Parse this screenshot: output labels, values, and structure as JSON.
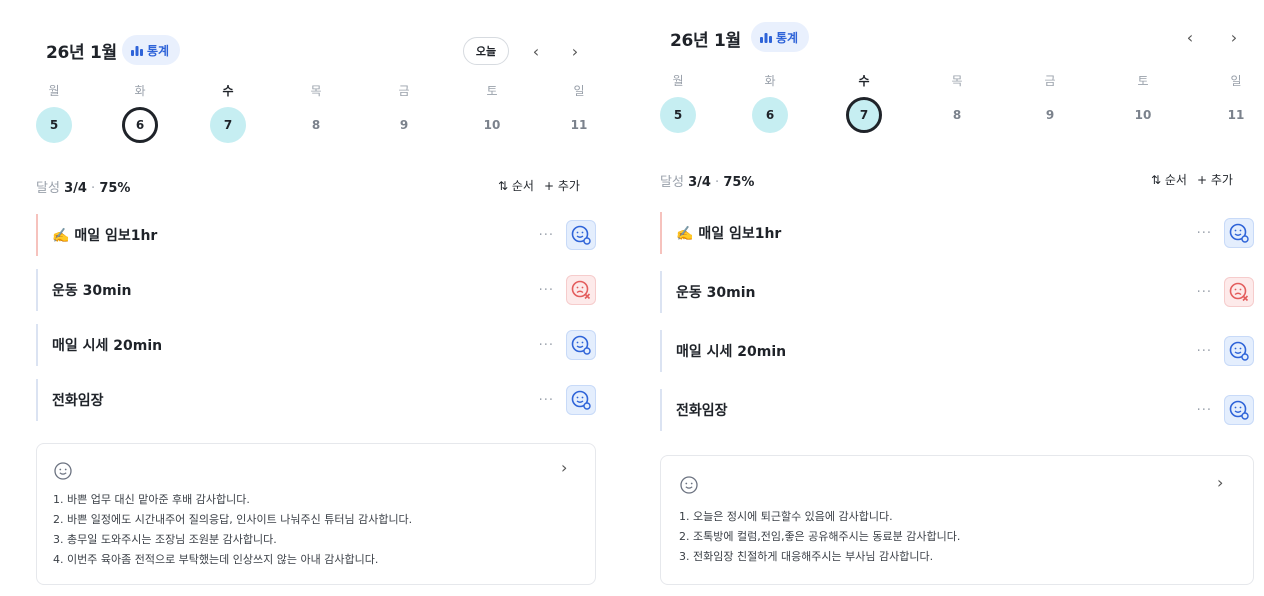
{
  "panels": [
    {
      "month_title": "26년 1월",
      "stats_label": "통계",
      "today_label": "오늘",
      "show_today": true,
      "prev_arrow": "‹",
      "next_arrow": "›",
      "weekdays": [
        "월",
        "화",
        "수",
        "목",
        "금",
        "토",
        "일"
      ],
      "days": [
        "5",
        "6",
        "7",
        "8",
        "9",
        "10",
        "11"
      ],
      "selected_day": "6",
      "achievement_prefix": "달성 ",
      "achievement_value": "3/4",
      "achievement_sep": " · ",
      "achievement_pct": "75%",
      "order_label": "⇅ 순서",
      "add_label": "+ 추가",
      "tasks": [
        {
          "emoji": "✍️",
          "title": "매일 임보1hr",
          "more": "···",
          "status": "success"
        },
        {
          "emoji": "",
          "title": "운동 30min",
          "more": "···",
          "status": "fail"
        },
        {
          "emoji": "",
          "title": "매일 시세 20min",
          "more": "···",
          "status": "success"
        },
        {
          "emoji": "",
          "title": "전화임장",
          "more": "···",
          "status": "success"
        }
      ],
      "gratitude_chevron": "›",
      "gratitude": [
        "1. 바쁜 업무 대신 맡아준 후배 감사합니다.",
        "2. 바쁜 일정에도 시간내주어 질의응답, 인사이트 나눠주신 튜터님 감사합니다.",
        "3. 총무일 도와주시는 조장님 조원분 감사합니다.",
        "4. 이번주 육아좀 전적으로 부탁했는데 인상쓰지 않는 아내 감사합니다."
      ]
    },
    {
      "month_title": "26년 1월",
      "stats_label": "통계",
      "today_label": "",
      "show_today": false,
      "prev_arrow": "‹",
      "next_arrow": "›",
      "weekdays": [
        "월",
        "화",
        "수",
        "목",
        "금",
        "토",
        "일"
      ],
      "days": [
        "5",
        "6",
        "7",
        "8",
        "9",
        "10",
        "11"
      ],
      "selected_day": "7",
      "achievement_prefix": "달성 ",
      "achievement_value": "3/4",
      "achievement_sep": " · ",
      "achievement_pct": "75%",
      "order_label": "⇅ 순서",
      "add_label": "+ 추가",
      "tasks": [
        {
          "emoji": "✍️",
          "title": "매일 임보1hr",
          "more": "···",
          "status": "success"
        },
        {
          "emoji": "",
          "title": "운동 30min",
          "more": "···",
          "status": "fail"
        },
        {
          "emoji": "",
          "title": "매일 시세 20min",
          "more": "···",
          "status": "success"
        },
        {
          "emoji": "",
          "title": "전화임장",
          "more": "···",
          "status": "success"
        }
      ],
      "gratitude_chevron": "›",
      "gratitude": [
        "1. 오늘은 정시에 퇴근할수 있음에 감사합니다.",
        "2. 조톡방에 컬럼,전임,좋은 공유해주시는 동료분 감사합니다.",
        "3. 전화임장 친절하게 대응해주시는 부사님 감사합니다."
      ]
    }
  ],
  "colors": {
    "accent_blue": "#2e63d8",
    "done_day": "#c6eef2",
    "fail_red": "#e35d5d",
    "text_dark": "#1f2329",
    "text_muted": "#9aa1ab"
  }
}
